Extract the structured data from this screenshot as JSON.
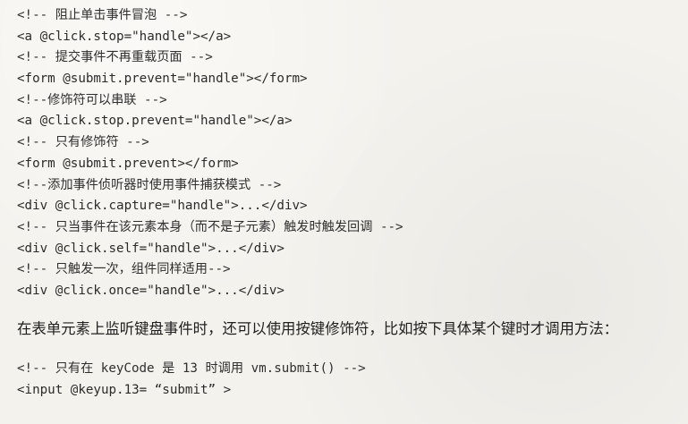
{
  "code_lines": [
    "<!-- 阻止单击事件冒泡 -->",
    "<a @click.stop=\"handle\"></a>",
    "<!-- 提交事件不再重载页面 -->",
    "<form @submit.prevent=\"handle\"></form>",
    "<!--修饰符可以串联 -->",
    "<a @click.stop.prevent=\"handle\"></a>",
    "<!-- 只有修饰符 -->",
    "<form @submit.prevent></form>",
    "<!--添加事件侦听器时使用事件捕获模式 -->",
    "<div @click.capture=\"handle\">...</div>",
    "<!-- 只当事件在该元素本身（而不是子元素）触发时触发回调 -->",
    "<div @click.self=\"handle\">...</div>",
    "<!-- 只触发一次，组件同样适用-->",
    "<div @click.once=\"handle\">...</div>"
  ],
  "prose_text": "在表单元素上监听键盘事件时，还可以使用按键修饰符，比如按下具体某个键时才调用方法：",
  "code_lines_2": [
    "<!-- 只有在 keyCode 是 13 时调用 vm.submit() -->",
    "<input @keyup.13= “submit” >"
  ]
}
